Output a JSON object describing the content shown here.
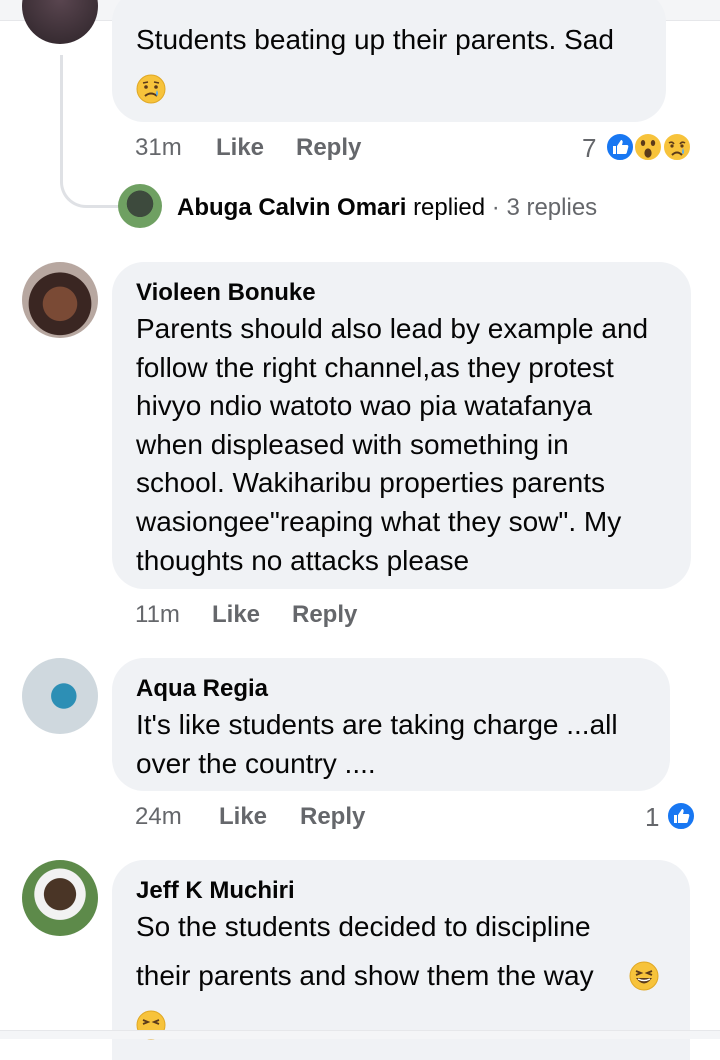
{
  "comment1": {
    "text_line1": "Students beating up their parents. Sad",
    "time": "31m",
    "like": "Like",
    "reply": "Reply",
    "reaction_count": "7",
    "replied_row": {
      "name": "Abuga Calvin Omari",
      "action": "replied",
      "separator": "·",
      "replies": "3 replies"
    }
  },
  "comment2": {
    "author": "Violeen Bonuke",
    "lines": [
      "Parents should also lead by example and",
      "follow the right channel,as they protest",
      "hivyo ndio watoto wao pia watafanya",
      "when displeased with something in",
      "school. Wakiharibu properties parents",
      "wasiongee\"reaping what they sow\". My",
      "thoughts no attacks please"
    ],
    "time": "11m",
    "like": "Like",
    "reply": "Reply"
  },
  "comment3": {
    "author": "Aqua Regia",
    "lines": [
      "It's like students are taking charge ...all",
      "over the country ...."
    ],
    "time": "24m",
    "like": "Like",
    "reply": "Reply",
    "reaction_count": "1"
  },
  "comment4": {
    "author": "Jeff K Muchiri",
    "lines": [
      "So the students decided to discipline",
      "their parents and show them the way"
    ]
  },
  "colors": {
    "bubble": "#f0f2f5",
    "like_blue": "#1877f2",
    "emoji_yellow": "#f7c33b",
    "muted": "#65676b"
  },
  "icons": [
    "sad-tear-emoji",
    "like-reaction-icon",
    "wow-reaction-icon",
    "sad-reaction-icon",
    "laughing-emoji",
    "grinning-squint-emoji"
  ]
}
